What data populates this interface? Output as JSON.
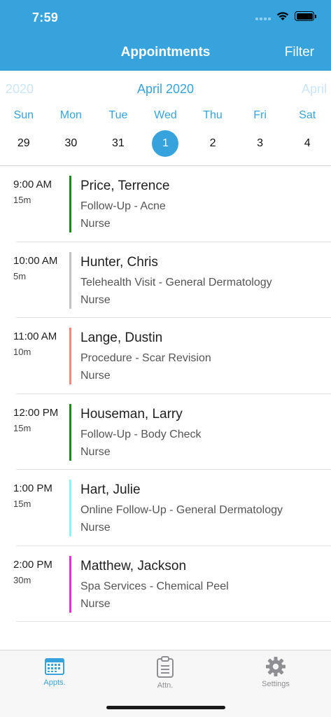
{
  "status_bar": {
    "time": "7:59"
  },
  "header": {
    "title": "Appointments",
    "filter_label": "Filter",
    "background": "#37a3dd"
  },
  "calendar": {
    "prev_month": "2020",
    "current_month": "April 2020",
    "next_month": "April",
    "weekdays": [
      "Sun",
      "Mon",
      "Tue",
      "Wed",
      "Thu",
      "Fri",
      "Sat"
    ],
    "dates": [
      "29",
      "30",
      "31",
      "1",
      "2",
      "3",
      "4"
    ],
    "selected_date": "1"
  },
  "appointments": [
    {
      "time": "9:00 AM",
      "duration": "15m",
      "name": "Price, Terrence",
      "type": "Follow-Up - Acne",
      "role": "Nurse",
      "color": "#1b8a1b"
    },
    {
      "time": "10:00 AM",
      "duration": "5m",
      "name": "Hunter, Chris",
      "type": "Telehealth Visit - General Dermatology",
      "role": "Nurse",
      "color": "#c3c3c3"
    },
    {
      "time": "11:00 AM",
      "duration": "10m",
      "name": "Lange, Dustin",
      "type": "Procedure - Scar Revision",
      "role": "Nurse",
      "color": "#f08a7e"
    },
    {
      "time": "12:00 PM",
      "duration": "15m",
      "name": "Houseman, Larry",
      "type": "Follow-Up - Body Check",
      "role": "Nurse",
      "color": "#1b8a1b"
    },
    {
      "time": "1:00 PM",
      "duration": "15m",
      "name": "Hart, Julie",
      "type": "Online Follow-Up - General Dermatology",
      "role": "Nurse",
      "color": "#8ef3f7"
    },
    {
      "time": "2:00 PM",
      "duration": "30m",
      "name": "Matthew, Jackson",
      "type": "Spa Services - Chemical Peel",
      "role": "Nurse",
      "color": "#e232d8"
    }
  ],
  "tabbar": {
    "tabs": [
      {
        "label": "Appts.",
        "icon": "calendar-icon",
        "active": true
      },
      {
        "label": "Attn.",
        "icon": "clipboard-icon",
        "active": false
      },
      {
        "label": "Settings",
        "icon": "gear-icon",
        "active": false
      }
    ]
  }
}
